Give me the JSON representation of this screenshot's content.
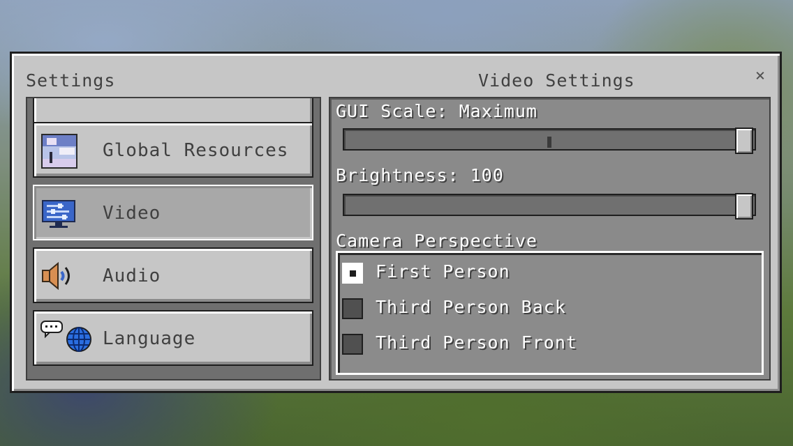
{
  "header": {
    "left_title": "Settings",
    "right_title": "Video Settings",
    "close_label": "×"
  },
  "sidebar": {
    "items": [
      {
        "label": "",
        "icon": "partial-hidden-icon"
      },
      {
        "label": "Global Resources",
        "icon": "resource-pack-icon"
      },
      {
        "label": "Video",
        "icon": "video-settings-icon",
        "selected": true
      },
      {
        "label": "Audio",
        "icon": "speaker-icon"
      },
      {
        "label": "Language",
        "icon": "language-globe-icon"
      }
    ]
  },
  "video": {
    "gui_scale": {
      "label": "GUI Scale: Maximum",
      "value": 1.0
    },
    "brightness": {
      "label": "Brightness: 100",
      "value": 100
    },
    "camera": {
      "label": "Camera Perspective",
      "options": [
        "First Person",
        "Third Person Back",
        "Third Person Front"
      ],
      "selected": "First Person"
    }
  },
  "colors": {
    "panel": "#c6c6c6",
    "accent_blue": "#3a66c8",
    "text_dark": "#404040"
  }
}
